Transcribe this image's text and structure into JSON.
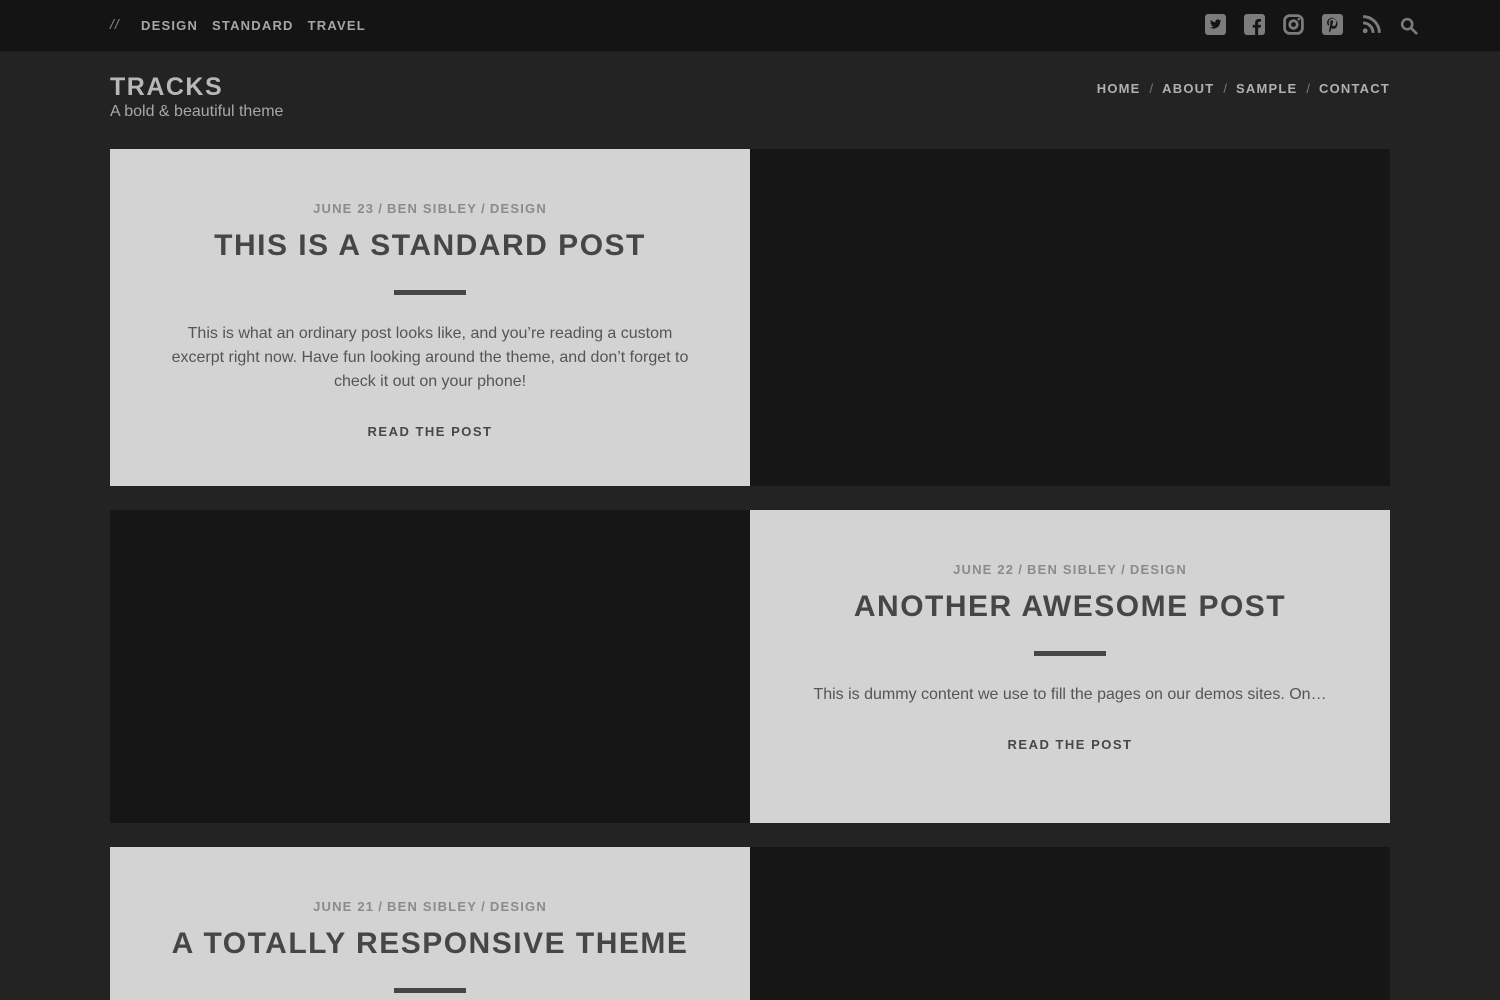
{
  "topbar": {
    "slashes": "//",
    "categories": [
      "DESIGN",
      "STANDARD",
      "TRAVEL"
    ],
    "social_icons": [
      "twitter-icon",
      "facebook-icon",
      "instagram-icon",
      "pinterest-icon",
      "rss-icon",
      "search-icon"
    ]
  },
  "header": {
    "site_title": "TRACKS",
    "tagline": "A bold & beautiful theme"
  },
  "nav": {
    "items": [
      "HOME",
      "ABOUT",
      "SAMPLE",
      "CONTACT"
    ],
    "separator": "/"
  },
  "posts": [
    {
      "date": "JUNE 23",
      "author": "BEN SIBLEY",
      "category": "DESIGN",
      "title": "THIS IS A STANDARD POST",
      "excerpt": "This is what an ordinary post looks like, and you’re reading a custom excerpt right now. Have fun looking around the theme, and don’t forget to check it out on your phone!",
      "read_more": "READ THE POST"
    },
    {
      "date": "JUNE 22",
      "author": "BEN SIBLEY",
      "category": "DESIGN",
      "title": "ANOTHER AWESOME POST",
      "excerpt": "This is dummy content we use to fill the pages on our demos sites. On…",
      "read_more": "READ THE POST"
    },
    {
      "date": "JUNE 21",
      "author": "BEN SIBLEY",
      "category": "DESIGN",
      "title": "A TOTALLY RESPONSIVE THEME"
    }
  ],
  "meta_separator": "/",
  "colors": {
    "page_bg": "#232323",
    "topbar_bg": "#141414",
    "card_bg": "#d3d3d3",
    "image_bg": "#161616",
    "title_text": "#464646"
  }
}
